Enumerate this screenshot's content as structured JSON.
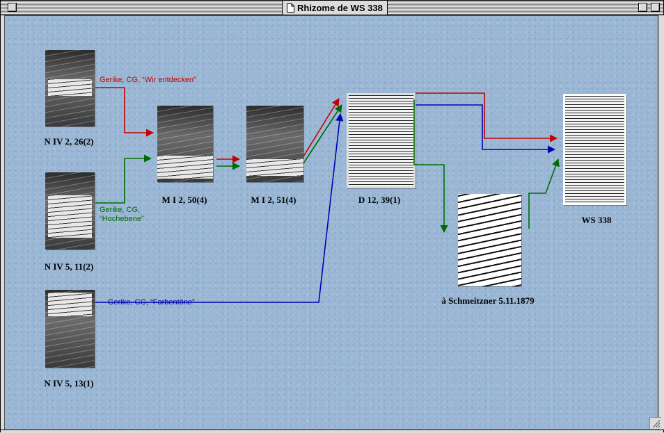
{
  "window": {
    "title": "Rhizome de WS 338"
  },
  "colors": {
    "red": "#c40000",
    "green": "#006b00",
    "blue": "#0000b4",
    "background": "#99b6d4"
  },
  "icons": {
    "title_icon": "document-icon",
    "close": "close-box-icon",
    "zoom": "zoom-box-icon",
    "collapse": "collapse-box-icon",
    "resize": "resize-grip-icon"
  },
  "documents": [
    {
      "id": "niv2",
      "label": "N IV 2, 26(2)"
    },
    {
      "id": "niv5a",
      "label": "N IV 5, 11(2)"
    },
    {
      "id": "niv5b",
      "label": "N IV 5, 13(1)"
    },
    {
      "id": "mi250",
      "label": "M I 2, 50(4)"
    },
    {
      "id": "mi251",
      "label": "M I 2, 51(4)"
    },
    {
      "id": "d12",
      "label": "D 12, 39(1)"
    },
    {
      "id": "schmeitzner",
      "label": "à Schmeitzner 5.11.1879"
    },
    {
      "id": "ws338",
      "label": "WS 338"
    }
  ],
  "annotations": {
    "red": "Gerike, CG, “Wir entdecken”",
    "green_line1": "Gerike, CG,",
    "green_line2": "“Hochebene”",
    "blue": "Gerike, CG, “Farbentöne”"
  }
}
